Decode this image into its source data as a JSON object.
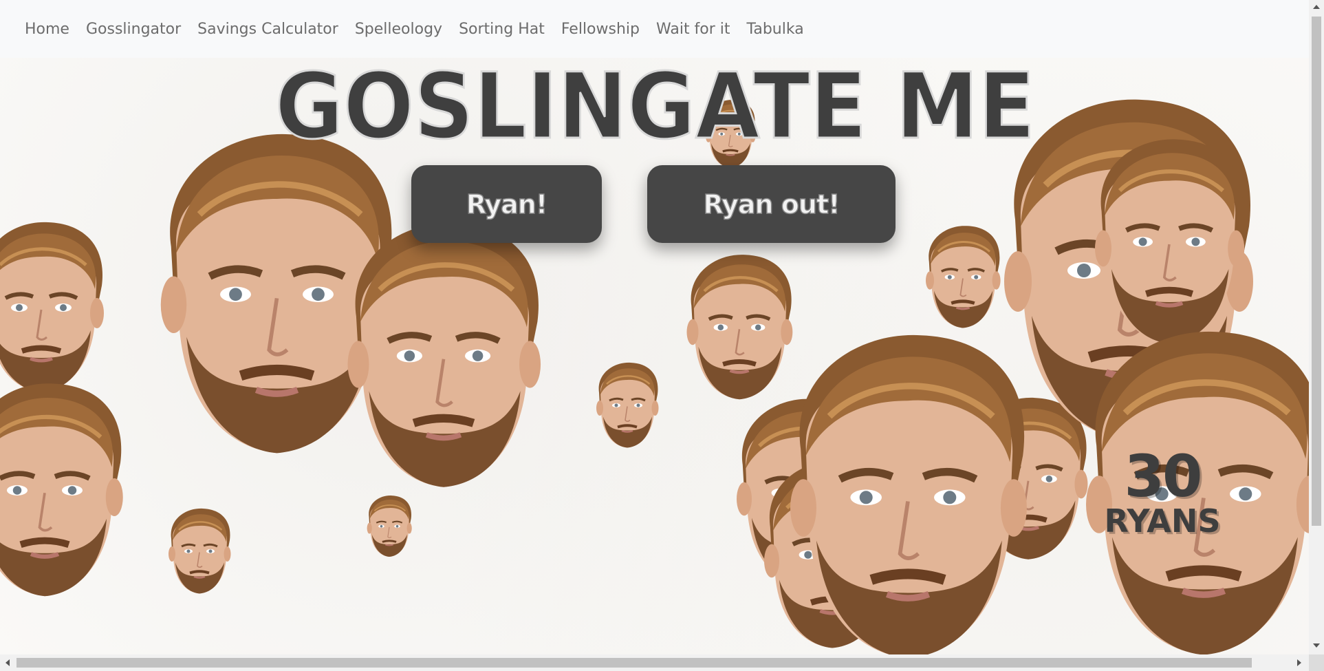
{
  "nav": {
    "items": [
      {
        "label": "Home"
      },
      {
        "label": "Gosslingator"
      },
      {
        "label": "Savings Calculator"
      },
      {
        "label": "Spelleology"
      },
      {
        "label": "Sorting Hat"
      },
      {
        "label": "Fellowship"
      },
      {
        "label": "Wait for it"
      },
      {
        "label": "Tabulka"
      }
    ]
  },
  "title": "GOSLINGATE ME",
  "buttons": {
    "add_label": "Ryan!",
    "remove_label": "Ryan out!"
  },
  "counter": {
    "count": "30",
    "unit": "RYANS"
  },
  "colors": {
    "button_bg": "#464646",
    "title_fill": "#3f3f3f",
    "nav_bg": "#f8f9fa",
    "nav_text": "#6c6c6c"
  },
  "faces": {
    "icon": "ryan-face-image"
  }
}
